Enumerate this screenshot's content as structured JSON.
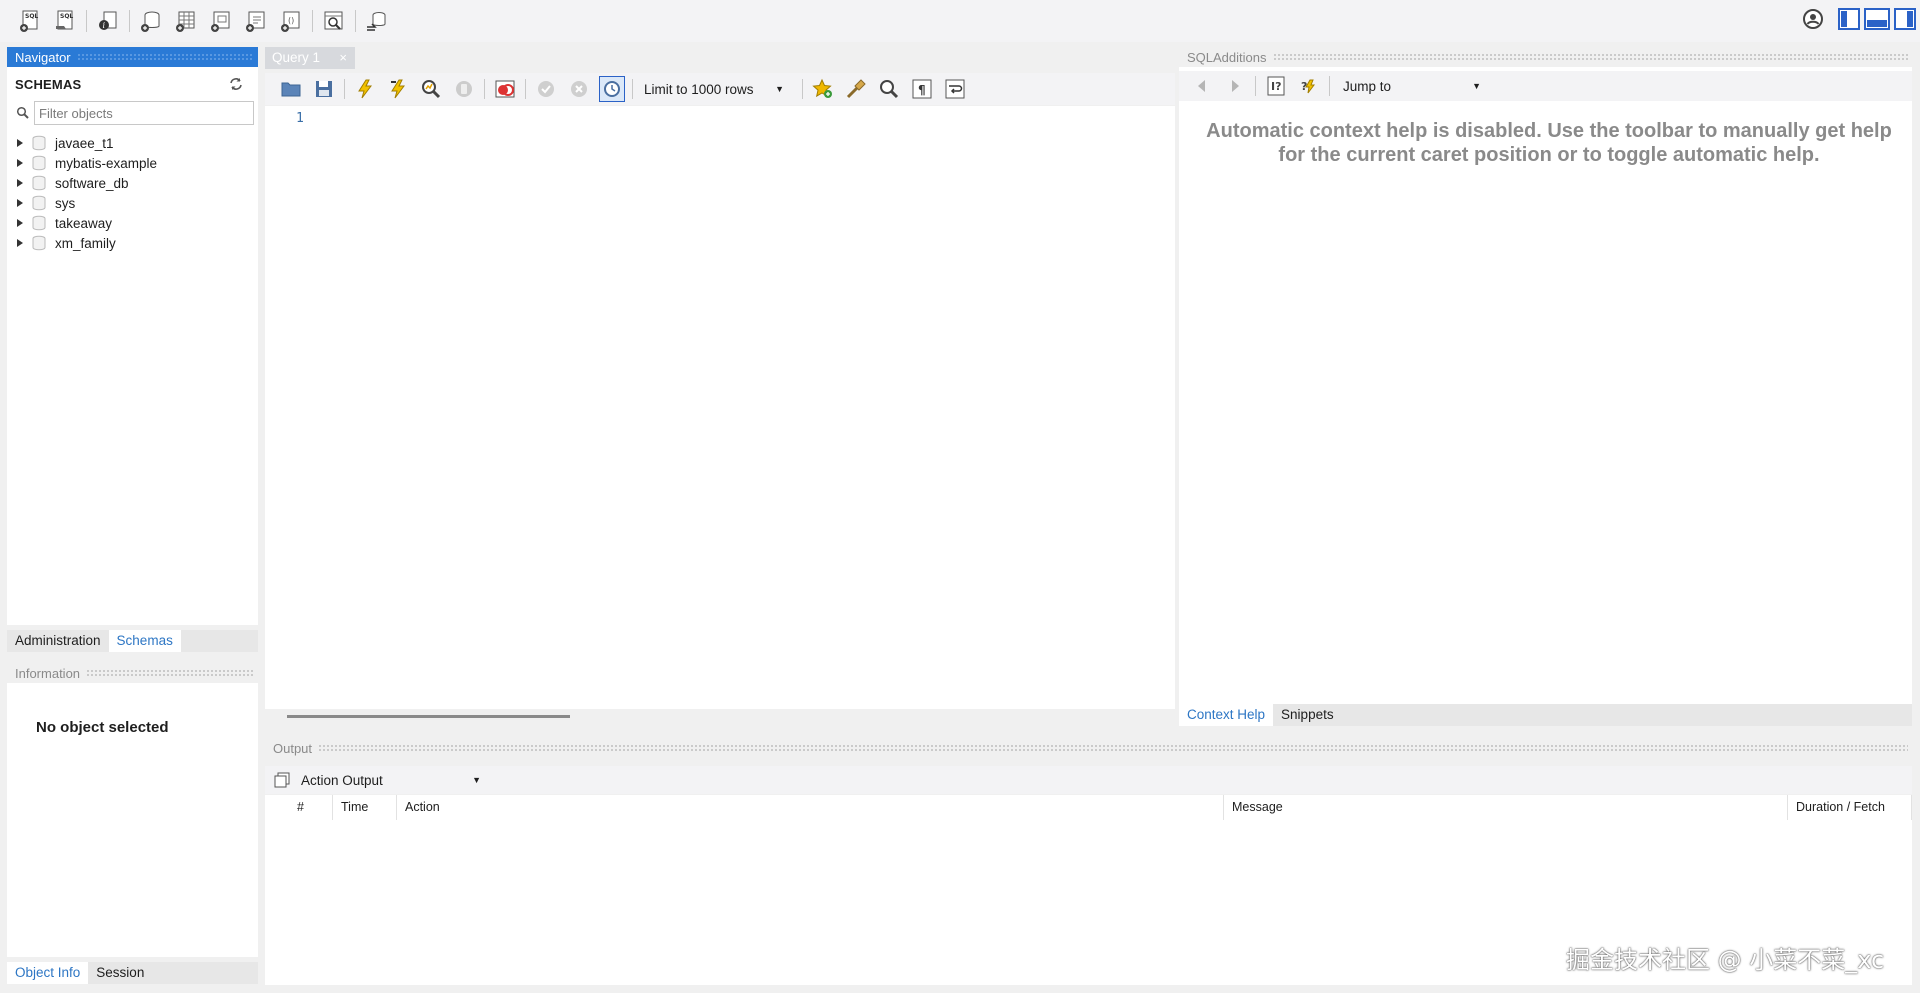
{
  "main_toolbar": {
    "icons": [
      "new-sql-tab-icon",
      "open-sql-script-icon",
      "inspector-icon",
      "create-schema-icon",
      "create-table-icon",
      "create-view-icon",
      "create-procedure-icon",
      "create-function-icon",
      "search-table-data-icon",
      "reconnect-icon"
    ]
  },
  "navigator": {
    "title": "Navigator",
    "schemas_label": "SCHEMAS",
    "filter_placeholder": "Filter objects",
    "schemas": [
      "javaee_t1",
      "mybatis-example",
      "software_db",
      "sys",
      "takeaway",
      "xm_family"
    ],
    "tabs": [
      "Administration",
      "Schemas"
    ],
    "active_tab": "Schemas"
  },
  "information": {
    "title": "Information",
    "message": "No object selected",
    "tabs": [
      "Object Info",
      "Session"
    ]
  },
  "query": {
    "tab_label": "Query 1",
    "tab_close": "×",
    "limit_label": "Limit to 1000 rows",
    "line_number": "1"
  },
  "sql_additions": {
    "title": "SQLAdditions",
    "jump_to": "Jump to",
    "help_text": "Automatic context help is disabled. Use the toolbar to manually get help for the current caret position or to toggle automatic help.",
    "tabs": [
      "Context Help",
      "Snippets"
    ]
  },
  "output": {
    "title": "Output",
    "selector": "Action Output",
    "columns": [
      "#",
      "Time",
      "Action",
      "Message",
      "Duration / Fetch"
    ]
  },
  "watermark": "掘金技术社区 @ 小菜不菜_xc",
  "colors": {
    "accent": "#2a7ad6",
    "tab_active_text": "#2d76c4"
  }
}
